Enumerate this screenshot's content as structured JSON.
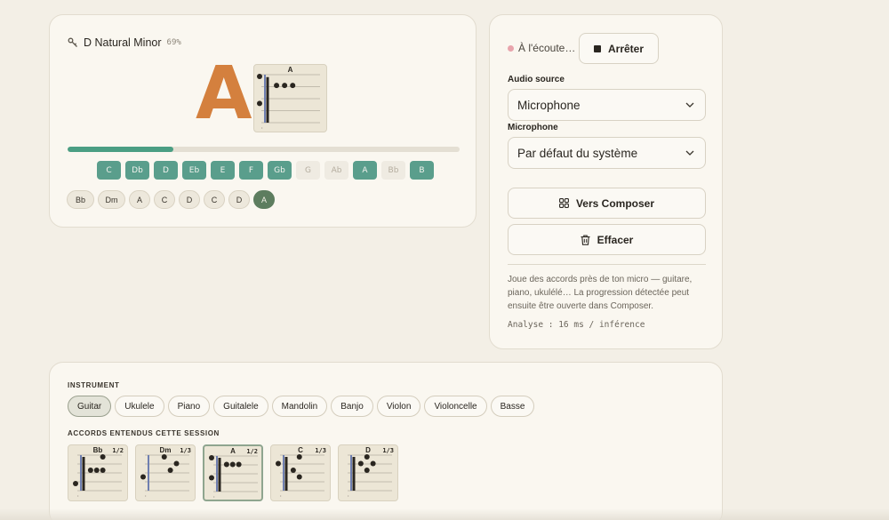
{
  "detector": {
    "scale_name": "D Natural Minor",
    "scale_confidence": "69%",
    "current_chord": "A",
    "current_chord_diagram": {
      "title": "A",
      "strings": 6,
      "frets": 4,
      "dots": [
        [
          0,
          0
        ],
        [
          1,
          1
        ],
        [
          1,
          2
        ],
        [
          1,
          3
        ],
        [
          3,
          0
        ]
      ],
      "barre": true
    },
    "stability_progress": 0.27,
    "notes": [
      {
        "label": "C",
        "active": true
      },
      {
        "label": "Db",
        "active": true
      },
      {
        "label": "D",
        "active": true
      },
      {
        "label": "Eb",
        "active": true
      },
      {
        "label": "E",
        "active": true
      },
      {
        "label": "F",
        "active": true
      },
      {
        "label": "Gb",
        "active": true
      },
      {
        "label": "G",
        "active": false
      },
      {
        "label": "Ab",
        "active": false
      },
      {
        "label": "A",
        "active": true
      },
      {
        "label": "Bb",
        "active": false
      },
      {
        "label": "B",
        "active": true
      }
    ],
    "history": [
      {
        "label": "Bb",
        "active": false
      },
      {
        "label": "Dm",
        "active": false
      },
      {
        "label": "A",
        "active": false
      },
      {
        "label": "C",
        "active": false
      },
      {
        "label": "D",
        "active": false
      },
      {
        "label": "C",
        "active": false
      },
      {
        "label": "D",
        "active": false
      },
      {
        "label": "A",
        "active": true
      }
    ]
  },
  "controls": {
    "listen_status": "À l'écoute…",
    "stop_label": "Arrêter",
    "audio_source_label": "Audio source",
    "audio_source_value": "Microphone",
    "microphone_label": "Microphone",
    "microphone_value": "Par défaut du système",
    "composer_label": "Vers Composer",
    "clear_label": "Effacer",
    "help_text": "Joue des accords près de ton micro — guitare, piano, ukulélé… La progression détectée peut ensuite être ouverte dans Composer.",
    "perf_text": "Analyse : 16 ms / inférence",
    "rec_color": "#e8a4ac"
  },
  "instruments": {
    "section_label": "INSTRUMENT",
    "items": [
      "Guitar",
      "Ukulele",
      "Piano",
      "Guitalele",
      "Mandolin",
      "Banjo",
      "Violon",
      "Violoncelle",
      "Basse"
    ],
    "active": "Guitar"
  },
  "heard": {
    "section_label": "ACCORDS ENTENDUS CETTE SESSION",
    "chords": [
      {
        "title": "Bb",
        "variant": "1/2",
        "selected": false,
        "dots": [
          [
            2,
            1
          ],
          [
            2,
            2
          ],
          [
            2,
            3
          ],
          [
            0,
            3
          ],
          [
            4,
            0
          ]
        ],
        "barre": true
      },
      {
        "title": "Dm",
        "variant": "1/3",
        "selected": false,
        "dots": [
          [
            0,
            2
          ],
          [
            1,
            4
          ],
          [
            2,
            3
          ],
          [
            3,
            0
          ]
        ],
        "barre": false
      },
      {
        "title": "A",
        "variant": "1/2",
        "selected": true,
        "dots": [
          [
            0,
            0
          ],
          [
            1,
            1
          ],
          [
            1,
            2
          ],
          [
            1,
            3
          ],
          [
            3,
            0
          ]
        ],
        "barre": true
      },
      {
        "title": "C",
        "variant": "1/3",
        "selected": false,
        "dots": [
          [
            0,
            2
          ],
          [
            1,
            0
          ],
          [
            2,
            1
          ],
          [
            3,
            2
          ]
        ],
        "barre": true
      },
      {
        "title": "D",
        "variant": "1/3",
        "selected": false,
        "dots": [
          [
            0,
            2
          ],
          [
            1,
            1
          ],
          [
            1,
            3
          ],
          [
            2,
            2
          ]
        ],
        "barre": true
      }
    ]
  },
  "colors": {
    "accent_orange": "#d4803e",
    "note_active": "#5a9e8c",
    "progress": "#4a9e83",
    "history_active": "#5d7d5f"
  }
}
